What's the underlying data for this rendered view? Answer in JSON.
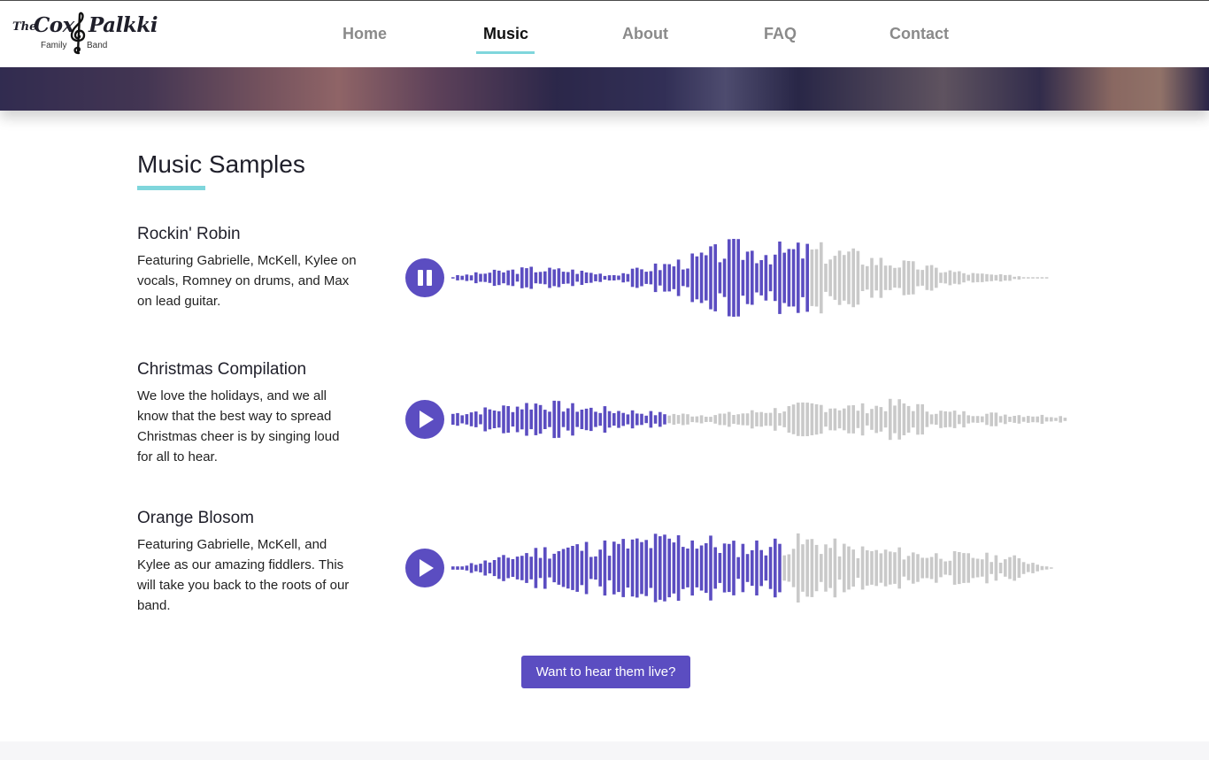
{
  "brand": {
    "the": "The",
    "cox": "Cox",
    "palkki": "Palkki",
    "family": "Family",
    "band": "Band",
    "clef_icon": "treble-clef-icon"
  },
  "nav": {
    "items": [
      {
        "label": "Home"
      },
      {
        "label": "Music"
      },
      {
        "label": "About"
      },
      {
        "label": "FAQ"
      },
      {
        "label": "Contact"
      }
    ],
    "active": "Music",
    "accent_color": "#7fd6dc"
  },
  "section": {
    "title": "Music Samples"
  },
  "colors": {
    "played": "#5b4dc1",
    "unplayed": "#c9c9c9",
    "accent": "#7fd6dc"
  },
  "tracks": [
    {
      "title": "Rockin' Robin",
      "description": "Featuring Gabrielle, McKell, Kylee on vocals, Romney on drums, and Max on lead guitar.",
      "state": "playing",
      "control_icon": "pause-icon",
      "progress": 0.6
    },
    {
      "title": "Christmas Compilation",
      "description": "We love the holidays, and we all know that the best way to spread Christmas cheer is by singing loud for all to hear.",
      "state": "paused",
      "control_icon": "play-icon",
      "progress": 0.35
    },
    {
      "title": "Orange Blosom",
      "description": "Featuring Gabrielle, McKell, and Kylee as our amazing fiddlers. This will take you back to the roots of our band.",
      "state": "paused",
      "control_icon": "play-icon",
      "progress": 0.55
    }
  ],
  "cta": {
    "label": "Want to hear them live?"
  }
}
